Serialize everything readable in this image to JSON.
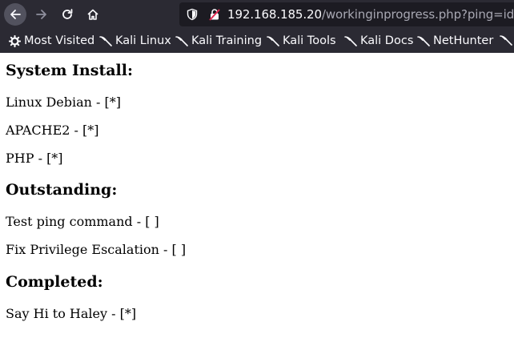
{
  "browser": {
    "url_host": "192.168.185.20",
    "url_path": "/workinginprogress.php?ping=id"
  },
  "bookmarks": [
    {
      "label": "Most Visited",
      "icon": "gear-icon"
    },
    {
      "label": "Kali Linux",
      "icon": "kali-dragon-icon"
    },
    {
      "label": "Kali Training",
      "icon": "kali-dragon-icon"
    },
    {
      "label": "Kali Tools",
      "icon": "kali-dragon-icon"
    },
    {
      "label": "Kali Docs",
      "icon": "kali-dragon-icon"
    },
    {
      "label": "NetHunter",
      "icon": "kali-dragon-icon"
    }
  ],
  "page": {
    "sections": [
      {
        "heading": "System Install:",
        "items": [
          "Linux Debian - [*]",
          "APACHE2 - [*]",
          "PHP - [*]"
        ]
      },
      {
        "heading": "Outstanding:",
        "items": [
          "Test ping command - [ ]",
          "Fix Privilege Escalation - [ ]"
        ]
      },
      {
        "heading": "Completed:",
        "items": [
          "Say Hi to Haley - [*]"
        ]
      }
    ]
  },
  "colors": {
    "toolbar_bg": "#2b2a33",
    "urlbar_bg": "#1c1b22",
    "text_light": "#fbfbfe",
    "url_path": "#a8a8b3"
  }
}
